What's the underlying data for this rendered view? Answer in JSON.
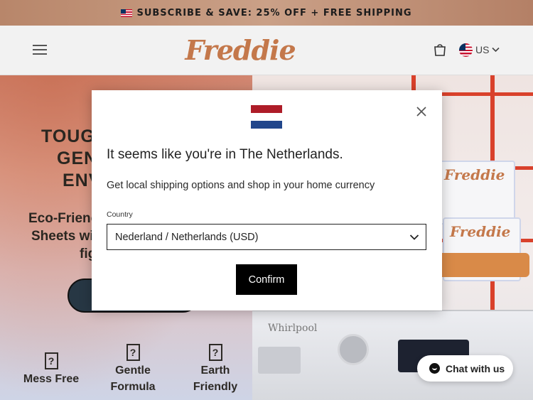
{
  "announcement": {
    "text": "SUBSCRIBE & SAVE: 25% OFF + FREE SHIPPING",
    "flag_icon": "us-flag-icon"
  },
  "header": {
    "logo_text": "Freddie",
    "menu_icon": "hamburger-menu-icon",
    "cart_icon": "cart-icon",
    "locale": {
      "label": "US",
      "flag_icon": "us-flag-icon",
      "chevron_icon": "chevron-down-icon"
    }
  },
  "hero": {
    "headline_lines": [
      "TOUG",
      "GEN",
      "ENV"
    ],
    "subhead_lines": [
      "Eco-Frienc",
      "Sheets wi",
      "fig"
    ],
    "features": [
      {
        "icon": "unknown-glyph-icon",
        "label_lines": [
          "Mess Free"
        ]
      },
      {
        "icon": "unknown-glyph-icon",
        "label_lines": [
          "Gentle",
          "Formula"
        ]
      },
      {
        "icon": "unknown-glyph-icon",
        "label_lines": [
          "Earth",
          "Friendly"
        ]
      }
    ],
    "photo_brand": "Whirlpool",
    "box_brand": "Freddie",
    "feature_icon_glyph": "?"
  },
  "modal": {
    "flag_icon": "netherlands-flag-icon",
    "flag_colors": [
      "#ae1c28",
      "#ffffff",
      "#21468b"
    ],
    "close_icon": "close-icon",
    "title": "It seems like you're in The Netherlands.",
    "subtitle": "Get local shipping options and shop in your home currency",
    "country_label": "Country",
    "country_selected": "Nederland / Netherlands (USD)",
    "confirm_label": "Confirm"
  },
  "chat": {
    "label": "Chat with us",
    "icon": "chat-icon"
  },
  "colors": {
    "brand": "#c4784b",
    "tile_grout": "#d9412b",
    "cta": "#273744"
  }
}
